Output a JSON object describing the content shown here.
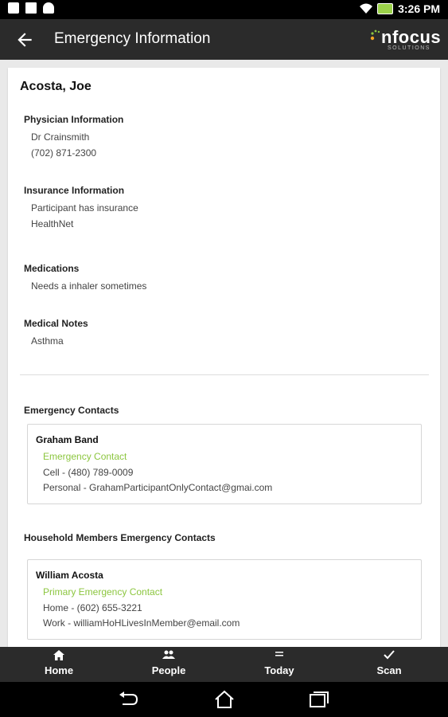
{
  "status_bar": {
    "time": "3:26 PM",
    "icons": [
      "screenshot-icon",
      "mail-icon",
      "android-icon",
      "wifi-icon",
      "battery-icon"
    ]
  },
  "app_bar": {
    "title": "Emergency Information",
    "logo_text": "nfocus",
    "logo_subtext": "SOLUTIONS"
  },
  "participant": {
    "name": "Acosta, Joe",
    "physician": {
      "title": "Physician Information",
      "name": "Dr Crainsmith",
      "phone": "(702) 871-2300"
    },
    "insurance": {
      "title": "Insurance Information",
      "status": "Participant has insurance",
      "provider": "HealthNet"
    },
    "medications": {
      "title": "Medications",
      "text": "Needs a inhaler sometimes"
    },
    "medical_notes": {
      "title": "Medical Notes",
      "text": "Asthma"
    }
  },
  "emergency_contacts": {
    "title": "Emergency Contacts",
    "contacts": [
      {
        "name": "Graham Band",
        "type": "Emergency Contact",
        "line1": "Cell - (480) 789-0009",
        "line2": "Personal - GrahamParticipantOnlyContact@gmai.com"
      }
    ]
  },
  "household_contacts": {
    "title": "Household Members Emergency Contacts",
    "contacts": [
      {
        "name": "William Acosta",
        "type": "Primary Emergency Contact",
        "line1": "Home - (602) 655-3221",
        "line2": "Work - williamHoHLivesInMember@email.com"
      }
    ]
  },
  "tabs": [
    {
      "label": "Home",
      "icon": "home-icon"
    },
    {
      "label": "People",
      "icon": "people-icon"
    },
    {
      "label": "Today",
      "icon": "list-icon"
    },
    {
      "label": "Scan",
      "icon": "check-icon"
    }
  ],
  "colors": {
    "accent_green": "#8cc63f",
    "app_bar": "#2b2b2b"
  }
}
